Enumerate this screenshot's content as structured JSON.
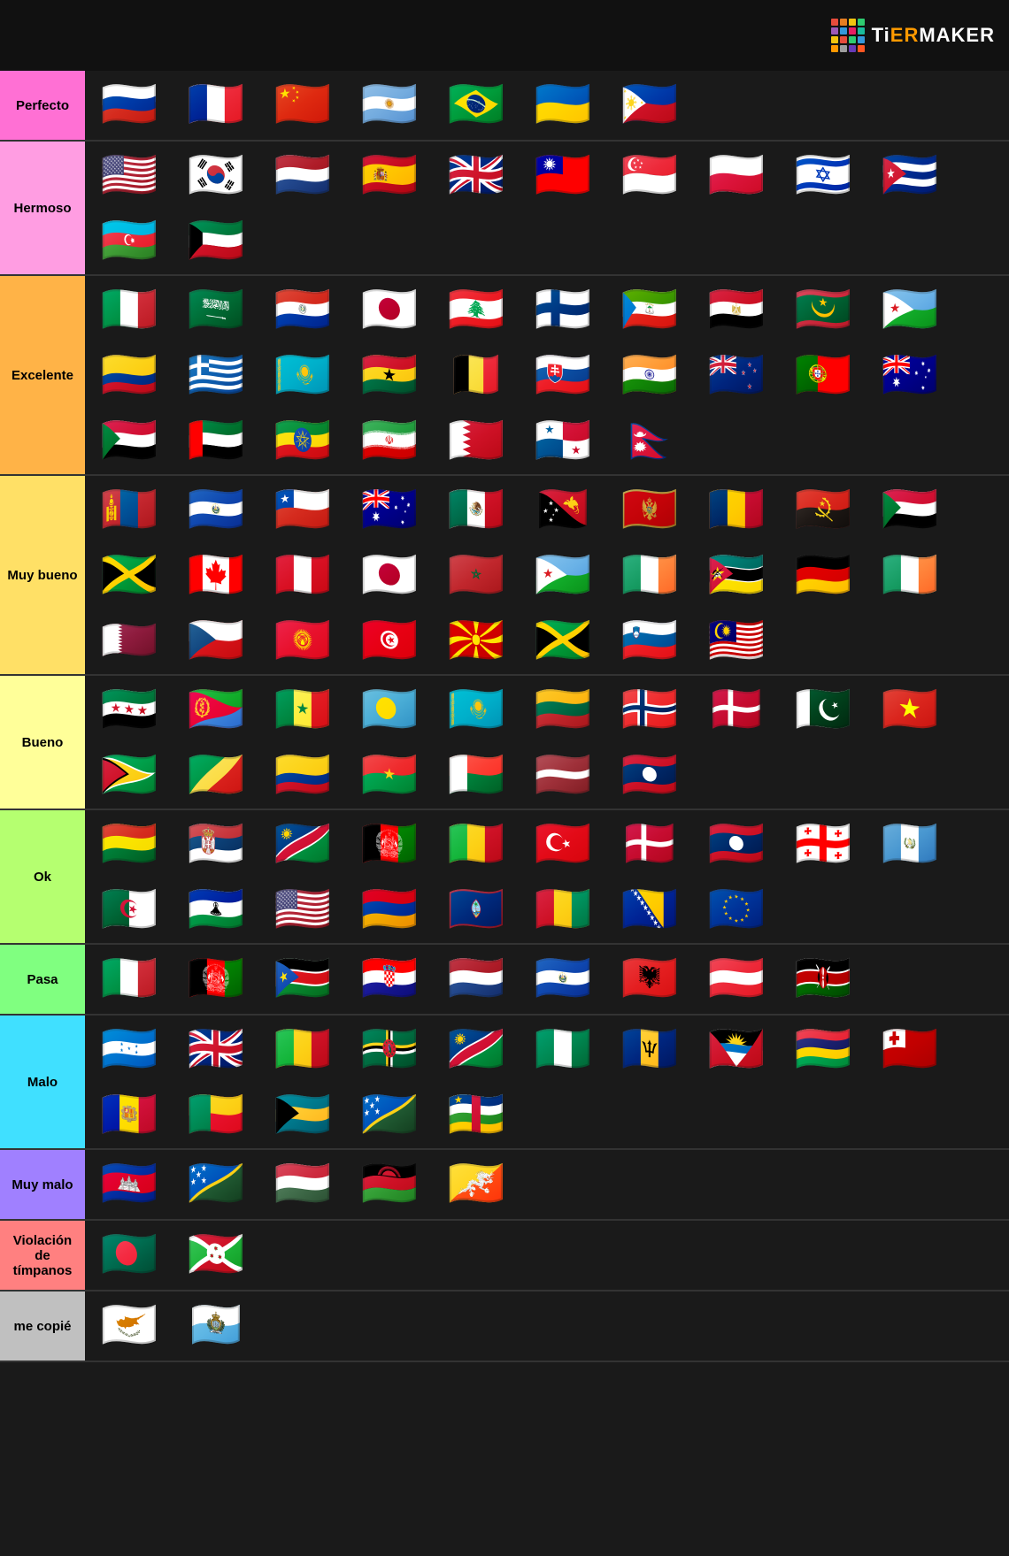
{
  "logo": {
    "text_before": "TiERMAKER",
    "colors": [
      "#e74c3c",
      "#e67e22",
      "#f1c40f",
      "#2ecc71",
      "#1abc9c",
      "#3498db",
      "#9b59b6",
      "#e91e63",
      "#00bcd4",
      "#8bc34a",
      "#ff5722",
      "#607d8b",
      "#ff9800",
      "#795548",
      "#9e9e9e",
      "#673ab7"
    ]
  },
  "tiers": [
    {
      "id": "perfecto",
      "label": "Perfecto",
      "color": "#ff70d4",
      "flags": [
        "🇷🇺",
        "🇫🇷",
        "🇨🇳",
        "🇦🇷",
        "🇧🇷",
        "🇺🇦",
        "🇵🇭"
      ]
    },
    {
      "id": "hermoso",
      "label": "Hermoso",
      "color": "#ff9de2",
      "flags": [
        "🇺🇸",
        "🇰🇷",
        "🇳🇱",
        "🇪🇸",
        "🇬🇧",
        "🇹🇼",
        "🇸🇬",
        "🇵🇱",
        "🇮🇱",
        "🇨🇺",
        "🇦🇿",
        "🇰🇼"
      ]
    },
    {
      "id": "excelente",
      "label": "Excelente",
      "color": "#ffb347",
      "flags": [
        "🇮🇹",
        "🇸🇦",
        "🇵🇾",
        "🇯🇵",
        "🇱🇧",
        "🇫🇮",
        "🇬🇶",
        "🇪🇬",
        "🇲🇷",
        "🇩🇯",
        "🇨🇴",
        "🇬🇷",
        "🇰🇿",
        "🇬🇭",
        "🇧🇪",
        "🇸🇰",
        "🇮🇳",
        "🇳🇿",
        "🇵🇹",
        "🇦🇺",
        "🇸🇩",
        "🇦🇪",
        "🇪🇹",
        "🇮🇷",
        "🇧🇭",
        "🇵🇦",
        "🇳🇵"
      ]
    },
    {
      "id": "muy-bueno",
      "label": "Muy bueno",
      "color": "#ffe066",
      "flags": [
        "🇲🇳",
        "🇸🇻",
        "🇨🇱",
        "🇦🇺",
        "🇲🇽",
        "🇵🇬",
        "🇲🇪",
        "🇹🇩",
        "🇦🇴",
        "🇸🇩",
        "🇯🇲",
        "🇨🇦",
        "🇵🇪",
        "🇯🇵",
        "🇲🇦",
        "🇩🇯",
        "🇮🇪",
        "🇲🇿",
        "🇩🇪",
        "🇮🇪",
        "🇶🇦",
        "🇨🇿",
        "🇰🇬",
        "🇹🇳",
        "🇲🇰",
        "🇯🇲",
        "🇸🇮",
        "🇲🇾"
      ]
    },
    {
      "id": "bueno",
      "label": "Bueno",
      "color": "#ffff99",
      "flags": [
        "🇸🇾",
        "🇪🇷",
        "🇸🇳",
        "🇵🇼",
        "🇰🇿",
        "🇱🇹",
        "🇳🇴",
        "🇩🇰",
        "🇵🇰",
        "🇻🇳",
        "🇬🇾",
        "🇨🇬",
        "🇨🇴",
        "🇧🇫",
        "🇲🇬",
        "🇱🇻",
        "🇱🇦"
      ]
    },
    {
      "id": "ok",
      "label": "Ok",
      "color": "#b5ff70",
      "flags": [
        "🇧🇴",
        "🇷🇸",
        "🇳🇦",
        "🇦🇫",
        "🇲🇱",
        "🇹🇷",
        "🇩🇰",
        "🇱🇦",
        "🇬🇪",
        "🇬🇹",
        "🇩🇿",
        "🇱🇸",
        "🇺🇸",
        "🇦🇲",
        "🇬🇺",
        "🇬🇳",
        "🇧🇦",
        "🇪🇺"
      ]
    },
    {
      "id": "pasa",
      "label": "Pasa",
      "color": "#80ff80",
      "flags": [
        "🇮🇹",
        "🇦🇫",
        "🇸🇸",
        "🇭🇷",
        "🇳🇱",
        "🇸🇻",
        "🇦🇱",
        "🇦🇹",
        "🇰🇪"
      ]
    },
    {
      "id": "malo",
      "label": "Malo",
      "color": "#40e0ff",
      "flags": [
        "🇭🇳",
        "🇬🇧",
        "🇲🇱",
        "🇩🇲",
        "🇳🇦",
        "🇳🇬",
        "🇧🇧",
        "🇦🇬",
        "🇲🇺",
        "🇹🇴",
        "🇦🇩",
        "🇧🇯",
        "🇧🇸",
        "🇸🇧",
        "🇨🇫"
      ]
    },
    {
      "id": "muy-malo",
      "label": "Muy malo",
      "color": "#a080ff",
      "flags": [
        "🇰🇭",
        "🇸🇧",
        "🇭🇺",
        "🇲🇼",
        "🇧🇹"
      ]
    },
    {
      "id": "violacion",
      "label": "Violación de tímpanos",
      "color": "#ff8080",
      "flags": [
        "🇧🇩",
        "🇧🇮"
      ]
    },
    {
      "id": "me-copie",
      "label": "me copié",
      "color": "#c0c0c0",
      "flags": [
        "🇨🇾",
        "🇸🇲"
      ]
    }
  ]
}
